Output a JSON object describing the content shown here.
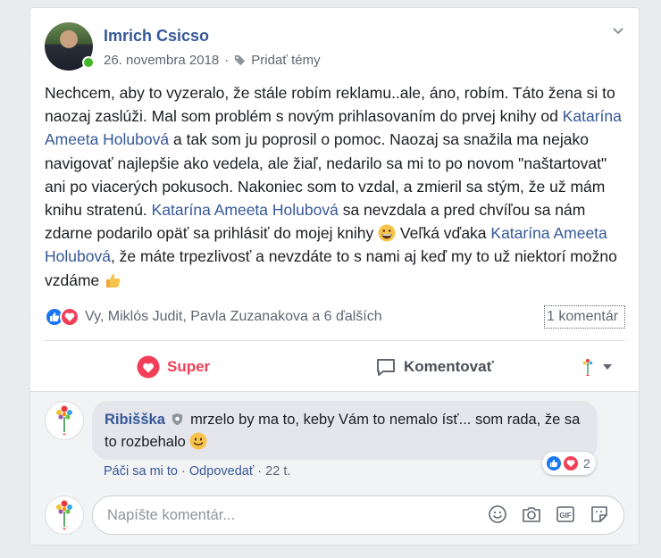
{
  "post": {
    "author": "Imrich Csicso",
    "date": "26. novembra 2018",
    "meta_separator": "·",
    "add_topics": "Pridať témy",
    "text": {
      "p1": "Nechcem, aby to vyzeralo, že stále robím reklamu..ale, áno, robím. Táto žena si to naozaj zaslúži. Mal som problém s novým prihlasovaním do prvej knihy od ",
      "mention": "Katarína Ameeta Holubová",
      "p2": " a tak som ju poprosil o pomoc. Naozaj sa snažila ma nejako navigovať najlepšie ako vedela, ale žiaľ, nedarilo sa mi to po novom \"naštartovat\" ani po viacerých pokusoch. Nakoniec som to vzdal, a zmieril sa stým, že už mám knihu stratenú. ",
      "p3": " sa nevzdala a pred chvíľou sa nám zdarne podarilo opäť sa prihlásiť do mojej knihy ",
      "p4": " Veľká vďaka ",
      "p5": ", že máte trpezlivosť a nevzdáte to s nami aj keď my to už niektorí možno vzdáme "
    },
    "reactions_text": "Vy, Miklós Judit, Pavla Zuzanakova a 6 ďalších",
    "comment_count": "1 komentár"
  },
  "actions": {
    "super_label": "Super",
    "comment_label": "Komentovať"
  },
  "comment": {
    "author": "Ribišška",
    "text": "mrzelo by ma to, keby Vám to nemalo ísť... som rada, že sa to rozbehalo ",
    "reaction_count": "2",
    "like_label": "Páči sa mi to",
    "reply_label": "Odpovedať",
    "separator": "·",
    "time": "22 t."
  },
  "composer": {
    "placeholder": "Napíšte komentár..."
  },
  "colors": {
    "link": "#365899",
    "love": "#f33e58",
    "like": "#1877f2",
    "online": "#42b72a"
  }
}
